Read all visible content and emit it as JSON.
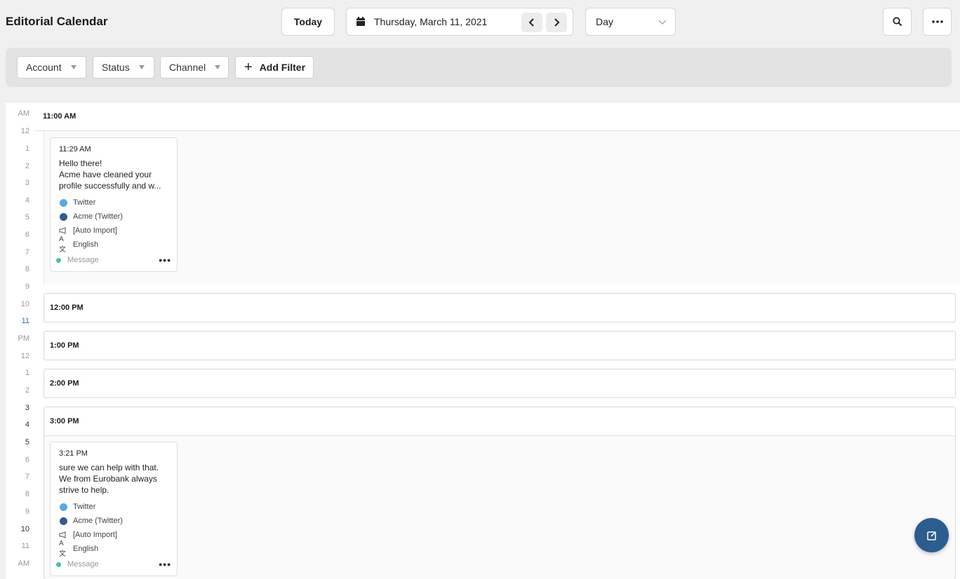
{
  "app": {
    "title": "Editorial Calendar"
  },
  "toolbar": {
    "today_label": "Today",
    "date_label": "Thursday, March 11, 2021",
    "view_label": "Day"
  },
  "filters": {
    "account": "Account",
    "status": "Status",
    "channel": "Channel",
    "add_filter": "Add Filter"
  },
  "hours": [
    "AM",
    "12",
    "1",
    "2",
    "3",
    "4",
    "5",
    "6",
    "7",
    "8",
    "9",
    "10",
    "11",
    "PM",
    "12",
    "1",
    "2",
    "3",
    "4",
    "5",
    "6",
    "7",
    "8",
    "9",
    "10",
    "11",
    "AM"
  ],
  "slots": {
    "s1100": "11:00 AM",
    "s1200": "12:00 PM",
    "s1300": "1:00 PM",
    "s1400": "2:00 PM",
    "s1500": "3:00 PM"
  },
  "posts": [
    {
      "time": "11:29 AM",
      "text_line1": "Hello there!",
      "text_line2": "Acme have cleaned your",
      "text_line3": "profile successfully and w...",
      "channel": "Twitter",
      "account": "Acme (Twitter)",
      "campaign": "[Auto Import]",
      "language": "English",
      "type": "Message"
    },
    {
      "time": "3:21 PM",
      "text_line1": "sure we can help with that.",
      "text_line2": "We from Eurobank always",
      "text_line3": "strive to help.",
      "channel": "Twitter",
      "account": "Acme (Twitter)",
      "campaign": "[Auto Import]",
      "language": "English",
      "type": "Message"
    }
  ],
  "colors": {
    "accent": "#2c5d8f",
    "twitter": "#5aa8e6",
    "status_green": "#4cc48a"
  }
}
